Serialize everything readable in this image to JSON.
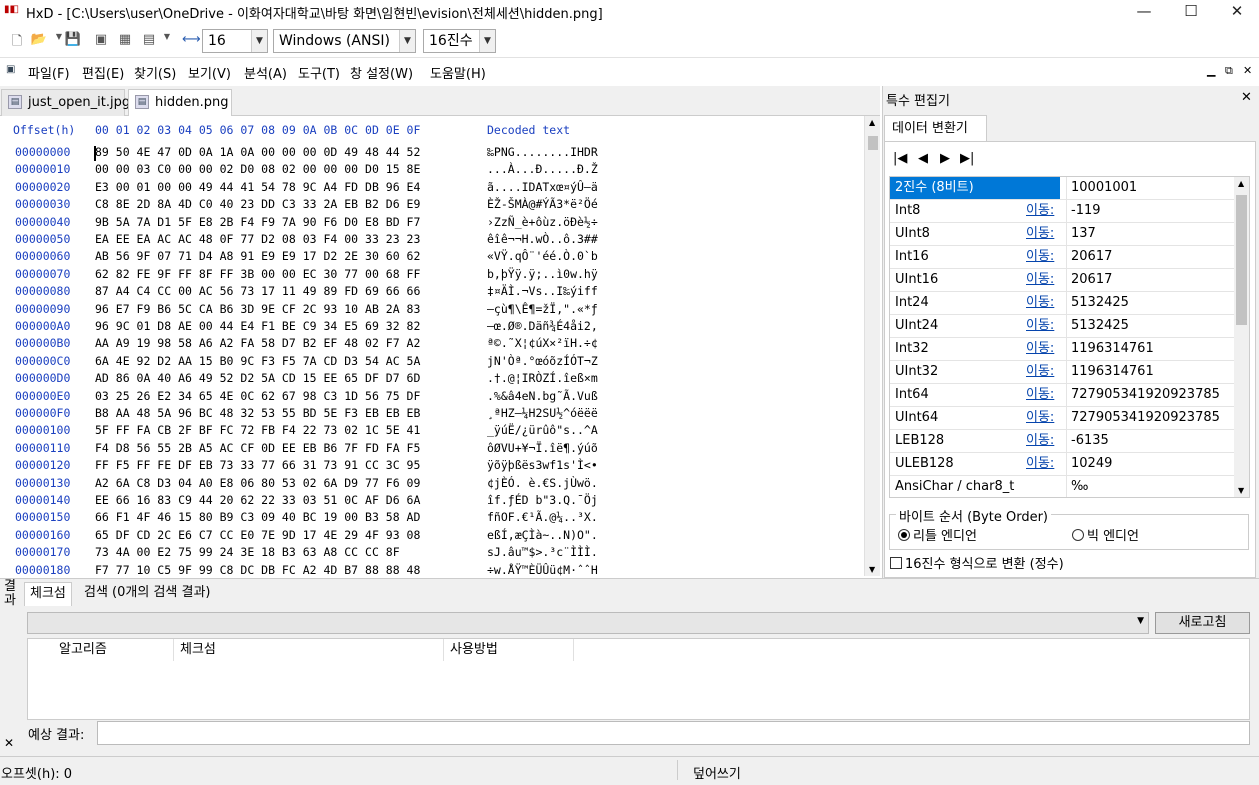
{
  "window": {
    "title": "HxD - [C:\\Users\\user\\OneDrive - 이화여자대학교\\바탕 화면\\임현빈\\evision\\전체세션\\hidden.png]"
  },
  "toolbar": {
    "bytes_per_row": "16",
    "charset": "Windows (ANSI)",
    "offset_base": "16진수"
  },
  "menu": [
    "파일(F)",
    "편집(E)",
    "찾기(S)",
    "보기(V)",
    "분석(A)",
    "도구(T)",
    "창 설정(W)",
    "도움말(H)"
  ],
  "tabs": [
    {
      "label": "just_open_it.jpg"
    },
    {
      "label": "hidden.png"
    }
  ],
  "hex": {
    "header_offset": "Offset(h)",
    "header_cols": "00 01 02 03 04 05 06 07 08 09 0A 0B 0C 0D 0E 0F",
    "header_decoded": "Decoded text",
    "rows": [
      {
        "offset": "00000000",
        "bytes": "89 50 4E 47 0D 0A 1A 0A 00 00 00 0D 49 48 44 52",
        "text": "‰PNG........IHDR"
      },
      {
        "offset": "00000010",
        "bytes": "00 00 03 C0 00 00 02 D0 08 02 00 00 00 D0 15 8E",
        "text": "...À...Ð.....Ð.Ž"
      },
      {
        "offset": "00000020",
        "bytes": "E3 00 01 00 00 49 44 41 54 78 9C A4 FD DB 96 E4",
        "text": "ã....IDATxœ¤ýÛ–ä"
      },
      {
        "offset": "00000030",
        "bytes": "C8 8E 2D 8A 4D C0 40 23 DD C3 33 2A EB B2 D6 E9",
        "text": "ÈŽ-ŠMÀ@#ÝÃ3*ë²Öé"
      },
      {
        "offset": "00000040",
        "bytes": "9B 5A 7A D1 5F E8 2B F4 F9 7A 90 F6 D0 E8 BD F7",
        "text": "›ZzÑ_è+ôùz.öÐè½÷"
      },
      {
        "offset": "00000050",
        "bytes": "EA EE EA AC AC 48 0F 77 D2 08 03 F4 00 33 23 23",
        "text": "êîê¬¬H.wÒ..ô.3##"
      },
      {
        "offset": "00000060",
        "bytes": "AB 56 9F 07 71 D4 A8 91 E9 E9 17 D2 2E 30 60 62",
        "text": "«VŸ.qÔ¨'éé.Ò.0`b"
      },
      {
        "offset": "00000070",
        "bytes": "62 82 FE 9F FF 8F FF 3B 00 00 EC 30 77 00 68 FF",
        "text": "b‚þŸÿ.ÿ;..ì0w.hÿ"
      },
      {
        "offset": "00000080",
        "bytes": "87 A4 C4 CC 00 AC 56 73 17 11 49 89 FD 69 66 66",
        "text": "‡¤ÄÌ.¬Vs..I‰ýiff"
      },
      {
        "offset": "00000090",
        "bytes": "96 E7 F9 B6 5C CA B6 3D 9E CF 2C 93 10 AB 2A 83",
        "text": "–çù¶\\Ê¶=žÏ,\".«*ƒ"
      },
      {
        "offset": "000000A0",
        "bytes": "96 9C 01 D8 AE 00 44 E4 F1 BE C9 34 E5 69 32 82",
        "text": "–œ.Ø®.Däñ¾É4åi2‚"
      },
      {
        "offset": "000000B0",
        "bytes": "AA A9 19 98 58 A6 A2 FA 58 D7 B2 EF 48 02 F7 A2",
        "text": "ª©.˜X¦¢úX×²ïH.÷¢"
      },
      {
        "offset": "000000C0",
        "bytes": "6A 4E 92 D2 AA 15 B0 9C F3 F5 7A CD D3 54 AC 5A",
        "text": "jN'Òª.°œóõzÍÓT¬Z"
      },
      {
        "offset": "000000D0",
        "bytes": "AD 86 0A 40 A6 49 52 D2 5A CD 15 EE 65 DF D7 6D",
        "text": ".†.@¦IRÒZÍ.îeß×m"
      },
      {
        "offset": "000000E0",
        "bytes": "03 25 26 E2 34 65 4E 0C 62 67 98 C3 1D 56 75 DF",
        "text": ".%&â4eN.bg˜Ã.Vuß"
      },
      {
        "offset": "000000F0",
        "bytes": "B8 AA 48 5A 96 BC 48 32 53 55 BD 5E F3 EB EB EB",
        "text": "¸ªHZ–¼H2SU½^óëëë"
      },
      {
        "offset": "00000100",
        "bytes": "5F FF FA CB 2F BF FC 72 FB F4 22 73 02 1C 5E 41",
        "text": "_ÿúË/¿ürûô\"s..^A"
      },
      {
        "offset": "00000110",
        "bytes": "F4 D8 56 55 2B A5 AC CF 0D EE EB B6 7F FD FA F5",
        "text": "ôØVU+¥¬Ï.îë¶.ýúõ"
      },
      {
        "offset": "00000120",
        "bytes": "FF F5 FF FE DF EB 73 33 77 66 31 73 91 CC 3C 95",
        "text": "ÿõÿþßës3wf1s'Ì<•"
      },
      {
        "offset": "00000130",
        "bytes": "A2 6A C8 D3 04 A0 E8 06 80 53 02 6A D9 77 F6 09",
        "text": "¢jÈÓ. è.€S.jÙwö."
      },
      {
        "offset": "00000140",
        "bytes": "EE 66 16 83 C9 44 20 62 22 33 03 51 0C AF D6 6A",
        "text": "îf.ƒÉD b\"3.Q.¯Öj"
      },
      {
        "offset": "00000150",
        "bytes": "66 F1 4F 46 15 80 B9 C3 09 40 BC 19 00 B3 58 AD",
        "text": "fñOF.€¹Ã.@¼..³X."
      },
      {
        "offset": "00000160",
        "bytes": "65 DF CD 2C E6 C7 CC E0 7E 9D 17 4E 29 4F 93 08",
        "text": "eßÍ,æÇÌà~..N)O\"."
      },
      {
        "offset": "00000170",
        "bytes": "73 4A 00 E2 75 99 24 3E 18 B3 63 A8 CC CC 8F",
        "text": "sJ.âu™$>.³c¨ÌÌÌ."
      },
      {
        "offset": "00000180",
        "bytes": "F7 77 10 C5 9F 99 C8 DC DB FC A2 4D B7 88 88 48",
        "text": "÷w.ÅŸ™ÈÜÛü¢M·ˆˆH"
      },
      {
        "offset": "00000190",
        "bytes": "FC 93 99 B1 D5 F6 7E A2 E3 86 E1 22 02 77 73 37",
        "text": "ü\"™±Õö~¢ã†á\".ws7"
      },
      {
        "offset": "000001A0",
        "bytes": "78 FC 62 7C 95 12 B7 1F 74 07 91 10 4B 4A CC B8",
        "text": "xüb|•.·.t.'.KJÌ¸"
      }
    ]
  },
  "special_editor": {
    "title": "특수 편집기",
    "tab": "데이터 변환기",
    "nav": [
      "|◀",
      "◀",
      "▶",
      "▶|"
    ],
    "rows": [
      {
        "label": "2진수 (8비트)",
        "link": "",
        "value": "10001001",
        "selected": true
      },
      {
        "label": "Int8",
        "link": "이동:",
        "value": "-119"
      },
      {
        "label": "UInt8",
        "link": "이동:",
        "value": "137"
      },
      {
        "label": "Int16",
        "link": "이동:",
        "value": "20617"
      },
      {
        "label": "UInt16",
        "link": "이동:",
        "value": "20617"
      },
      {
        "label": "Int24",
        "link": "이동:",
        "value": "5132425"
      },
      {
        "label": "UInt24",
        "link": "이동:",
        "value": "5132425"
      },
      {
        "label": "Int32",
        "link": "이동:",
        "value": "1196314761"
      },
      {
        "label": "UInt32",
        "link": "이동:",
        "value": "1196314761"
      },
      {
        "label": "Int64",
        "link": "이동:",
        "value": "727905341920923785"
      },
      {
        "label": "UInt64",
        "link": "이동:",
        "value": "727905341920923785"
      },
      {
        "label": "LEB128",
        "link": "이동:",
        "value": "-6135"
      },
      {
        "label": "ULEB128",
        "link": "이동:",
        "value": "10249"
      },
      {
        "label": "AnsiChar / char8_t",
        "link": "",
        "value": "‰"
      }
    ],
    "byte_order_title": "바이트 순서 (Byte Order)",
    "little_endian": "리틀 엔디언",
    "big_endian": "빅 엔디언",
    "hex_convert": "16진수 형식으로 변환 (정수)"
  },
  "results": {
    "side_label": "결과",
    "tab_checksum": "체크섬",
    "tab_search": "검색 (0개의 검색 결과)",
    "refresh": "새로고침",
    "col_algorithm": "알고리즘",
    "col_checksum": "체크섬",
    "col_usage": "사용방법",
    "expected_label": "예상 결과:"
  },
  "status": {
    "offset": "오프셋(h): 0",
    "mode": "덮어쓰기"
  }
}
